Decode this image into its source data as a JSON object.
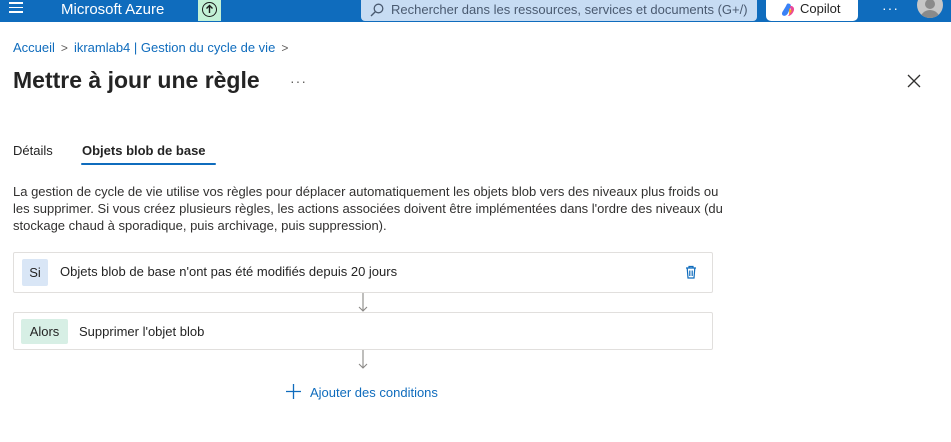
{
  "topbar": {
    "brand": "Microsoft Azure",
    "search_placeholder": "Rechercher dans les ressources, services et documents (G+/)",
    "copilot_label": "Copilot",
    "more": "···",
    "color": "#0f6cbd"
  },
  "breadcrumb": {
    "items": [
      "Accueil",
      "ikramlab4 | Gestion du cycle de vie"
    ],
    "separator": ">"
  },
  "page": {
    "title": "Mettre à jour une règle",
    "more": "···"
  },
  "tabs": [
    {
      "label": "Détails",
      "active": false
    },
    {
      "label": "Objets blob de base",
      "active": true
    }
  ],
  "description": "La gestion de cycle de vie utilise vos règles pour déplacer automatiquement les objets blob vers des niveaux plus froids ou les supprimer. Si vous créez plusieurs règles, les actions associées doivent être implémentées dans l'ordre des niveaux (du stockage chaud à sporadique, puis archivage, puis suppression).",
  "conditions": {
    "if": {
      "badge": "Si",
      "text": "Objets blob de base n'ont pas été modifiés depuis 20 jours"
    },
    "then": {
      "badge": "Alors",
      "text": "Supprimer l'objet blob"
    }
  },
  "add_conditions_label": "Ajouter des conditions",
  "icons": {
    "menu": "hamburger-icon",
    "upload": "upload-icon",
    "search": "search-icon",
    "copilot": "copilot-icon",
    "avatar": "user-avatar",
    "close": "close-icon",
    "delete": "trash-icon",
    "arrow": "arrow-down-icon",
    "add": "plus-icon"
  }
}
